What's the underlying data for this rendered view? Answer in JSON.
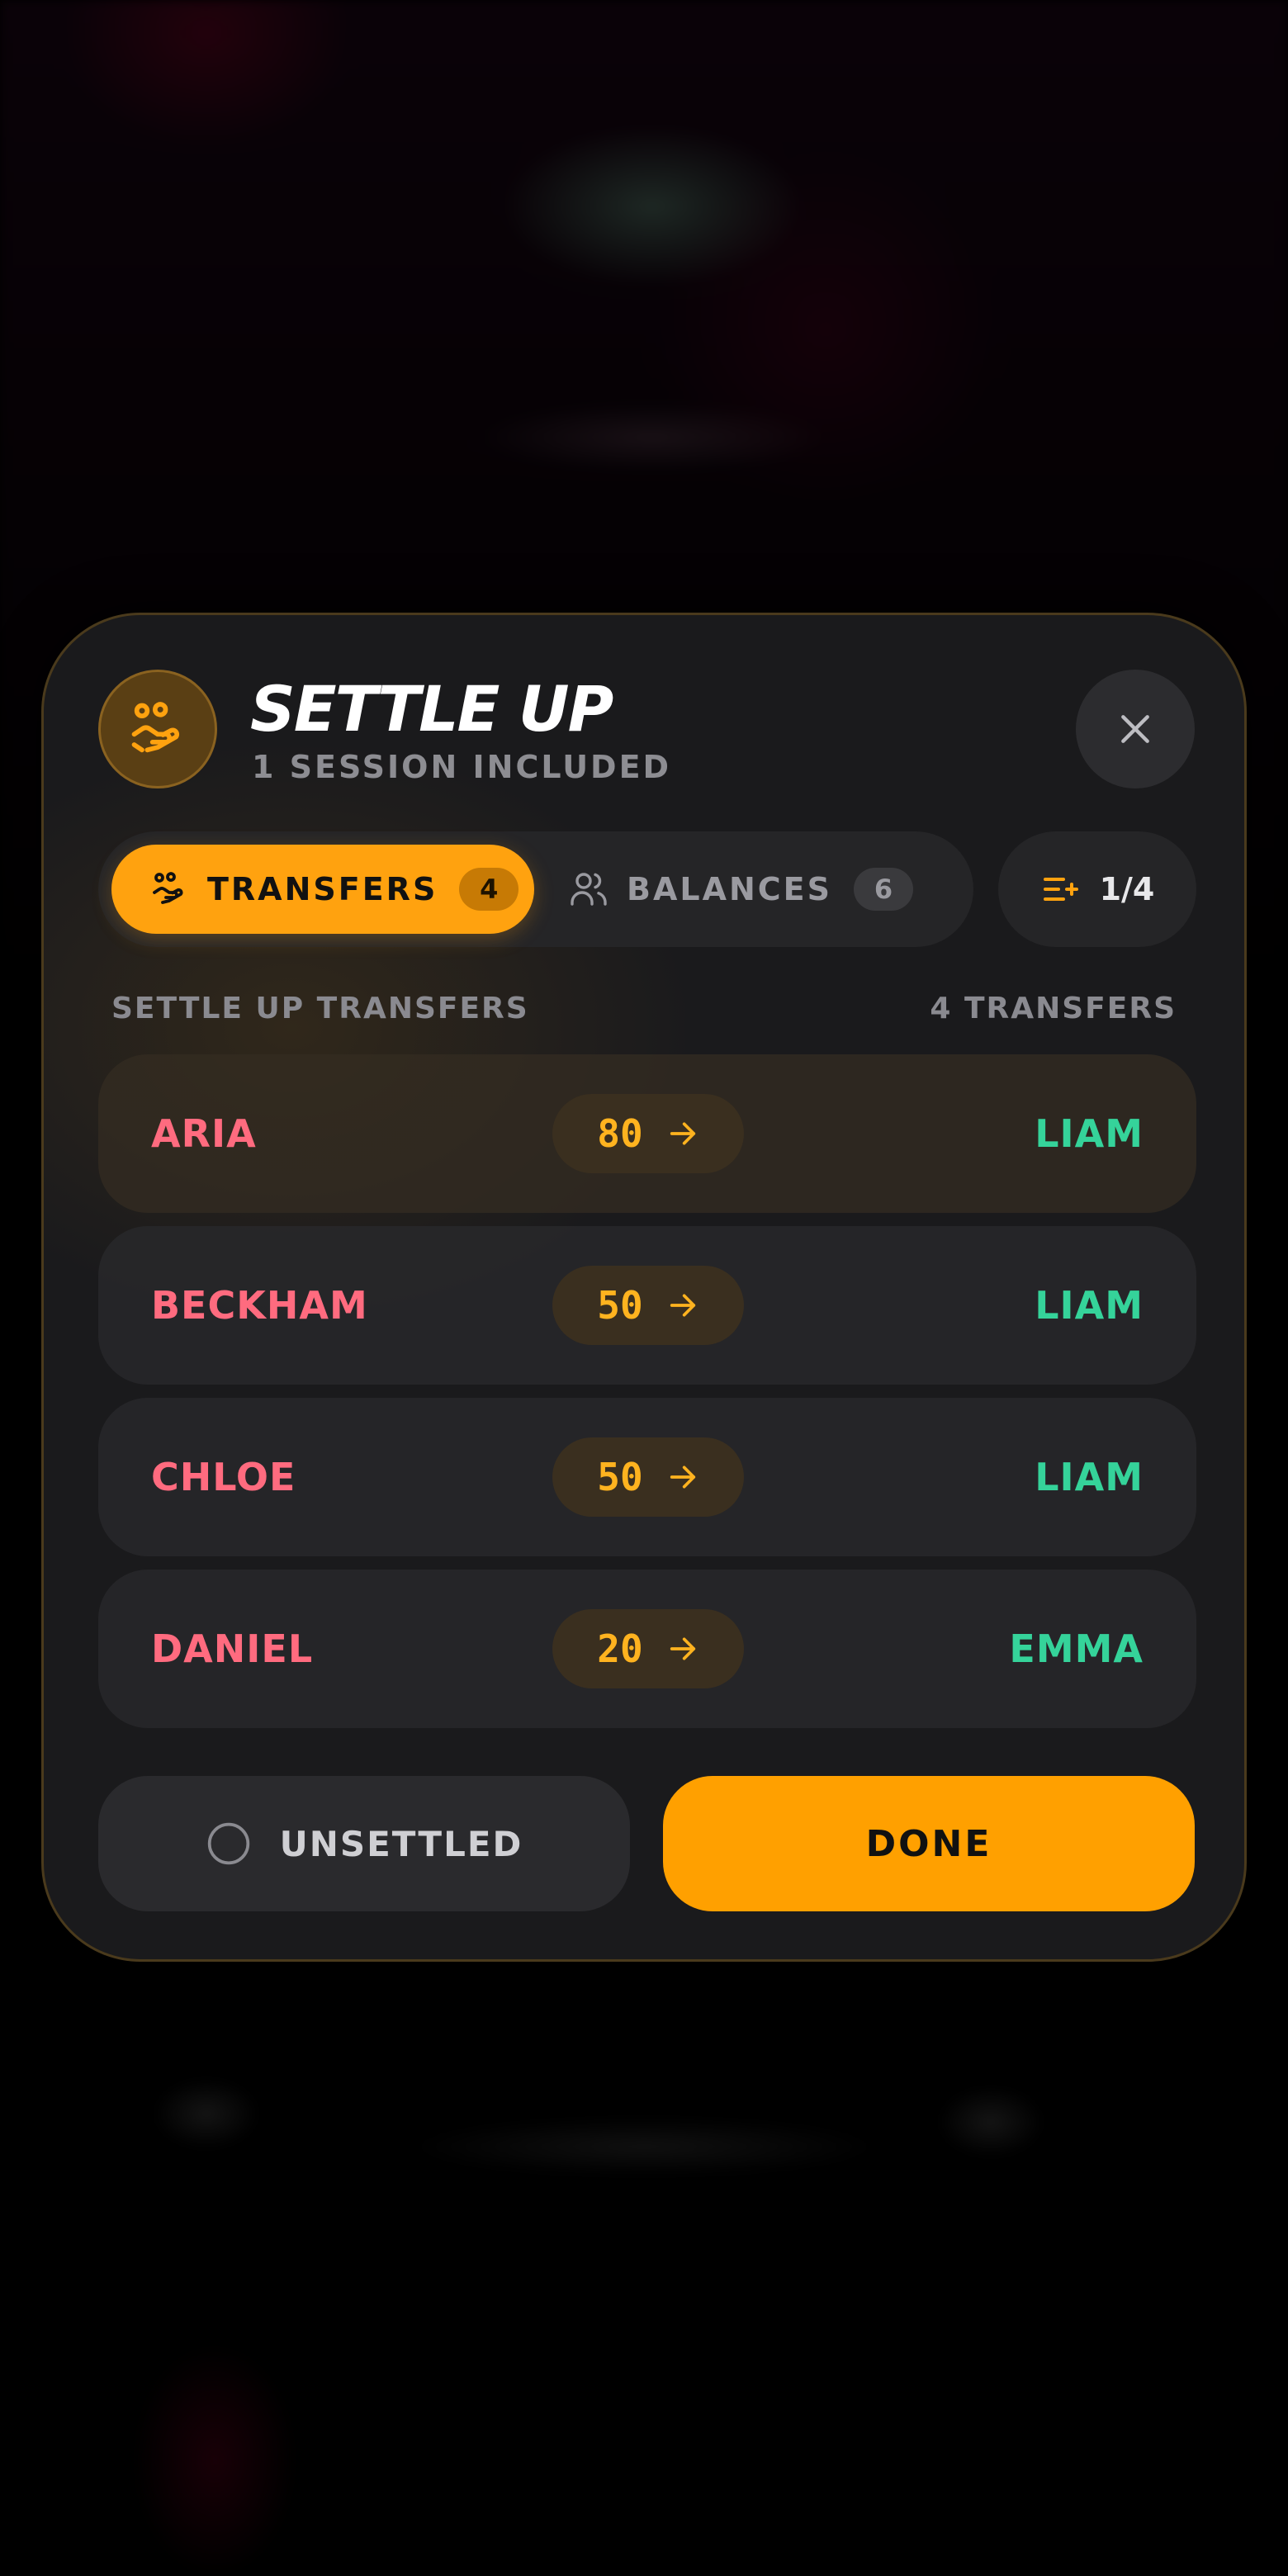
{
  "header": {
    "title": "SETTLE UP",
    "subtitle": "1 SESSION INCLUDED"
  },
  "tabs": [
    {
      "label": "TRANSFERS",
      "count": "4",
      "active": true,
      "icon": "hand-coins-icon"
    },
    {
      "label": "BALANCES",
      "count": "6",
      "active": false,
      "icon": "users-icon"
    }
  ],
  "pager": {
    "text": "1/4",
    "icon": "list-plus-icon"
  },
  "section": {
    "label": "SETTLE UP TRANSFERS",
    "count_text": "4 TRANSFERS"
  },
  "transfers": [
    {
      "from": "ARIA",
      "amount": "80",
      "to": "LIAM"
    },
    {
      "from": "BECKHAM",
      "amount": "50",
      "to": "LIAM"
    },
    {
      "from": "CHLOE",
      "amount": "50",
      "to": "LIAM"
    },
    {
      "from": "DANIEL",
      "amount": "20",
      "to": "EMMA"
    }
  ],
  "footer": {
    "unsettled_label": "UNSETTLED",
    "done_label": "DONE"
  },
  "colors": {
    "accent": "#ffa20f",
    "payer": "#ff6b7f",
    "payee": "#35d39a",
    "amount": "#ffb31f"
  }
}
